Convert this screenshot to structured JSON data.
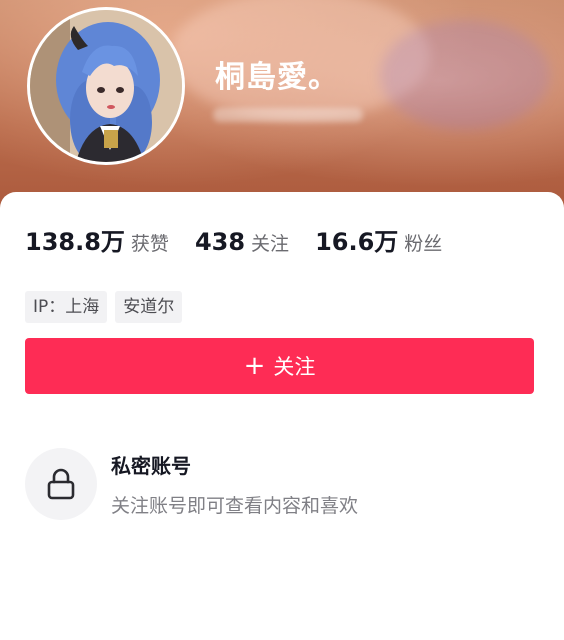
{
  "profile": {
    "nickname": "桐島愛。",
    "avatar_icon": "avatar-photo"
  },
  "stats": [
    {
      "value": "138.8万",
      "label": "获赞"
    },
    {
      "value": "438",
      "label": "关注"
    },
    {
      "value": "16.6万",
      "label": "粉丝"
    }
  ],
  "tags": [
    {
      "label": "IP：上海"
    },
    {
      "label": "安道尔"
    }
  ],
  "follow_button": {
    "icon": "plus",
    "label": "关注"
  },
  "private_account": {
    "icon": "lock-icon",
    "title": "私密账号",
    "description": "关注账号即可查看内容和喜欢"
  },
  "colors": {
    "accent": "#fe2c55",
    "header": "#b86a4a",
    "text_primary": "#161823",
    "text_secondary": "#808086"
  }
}
